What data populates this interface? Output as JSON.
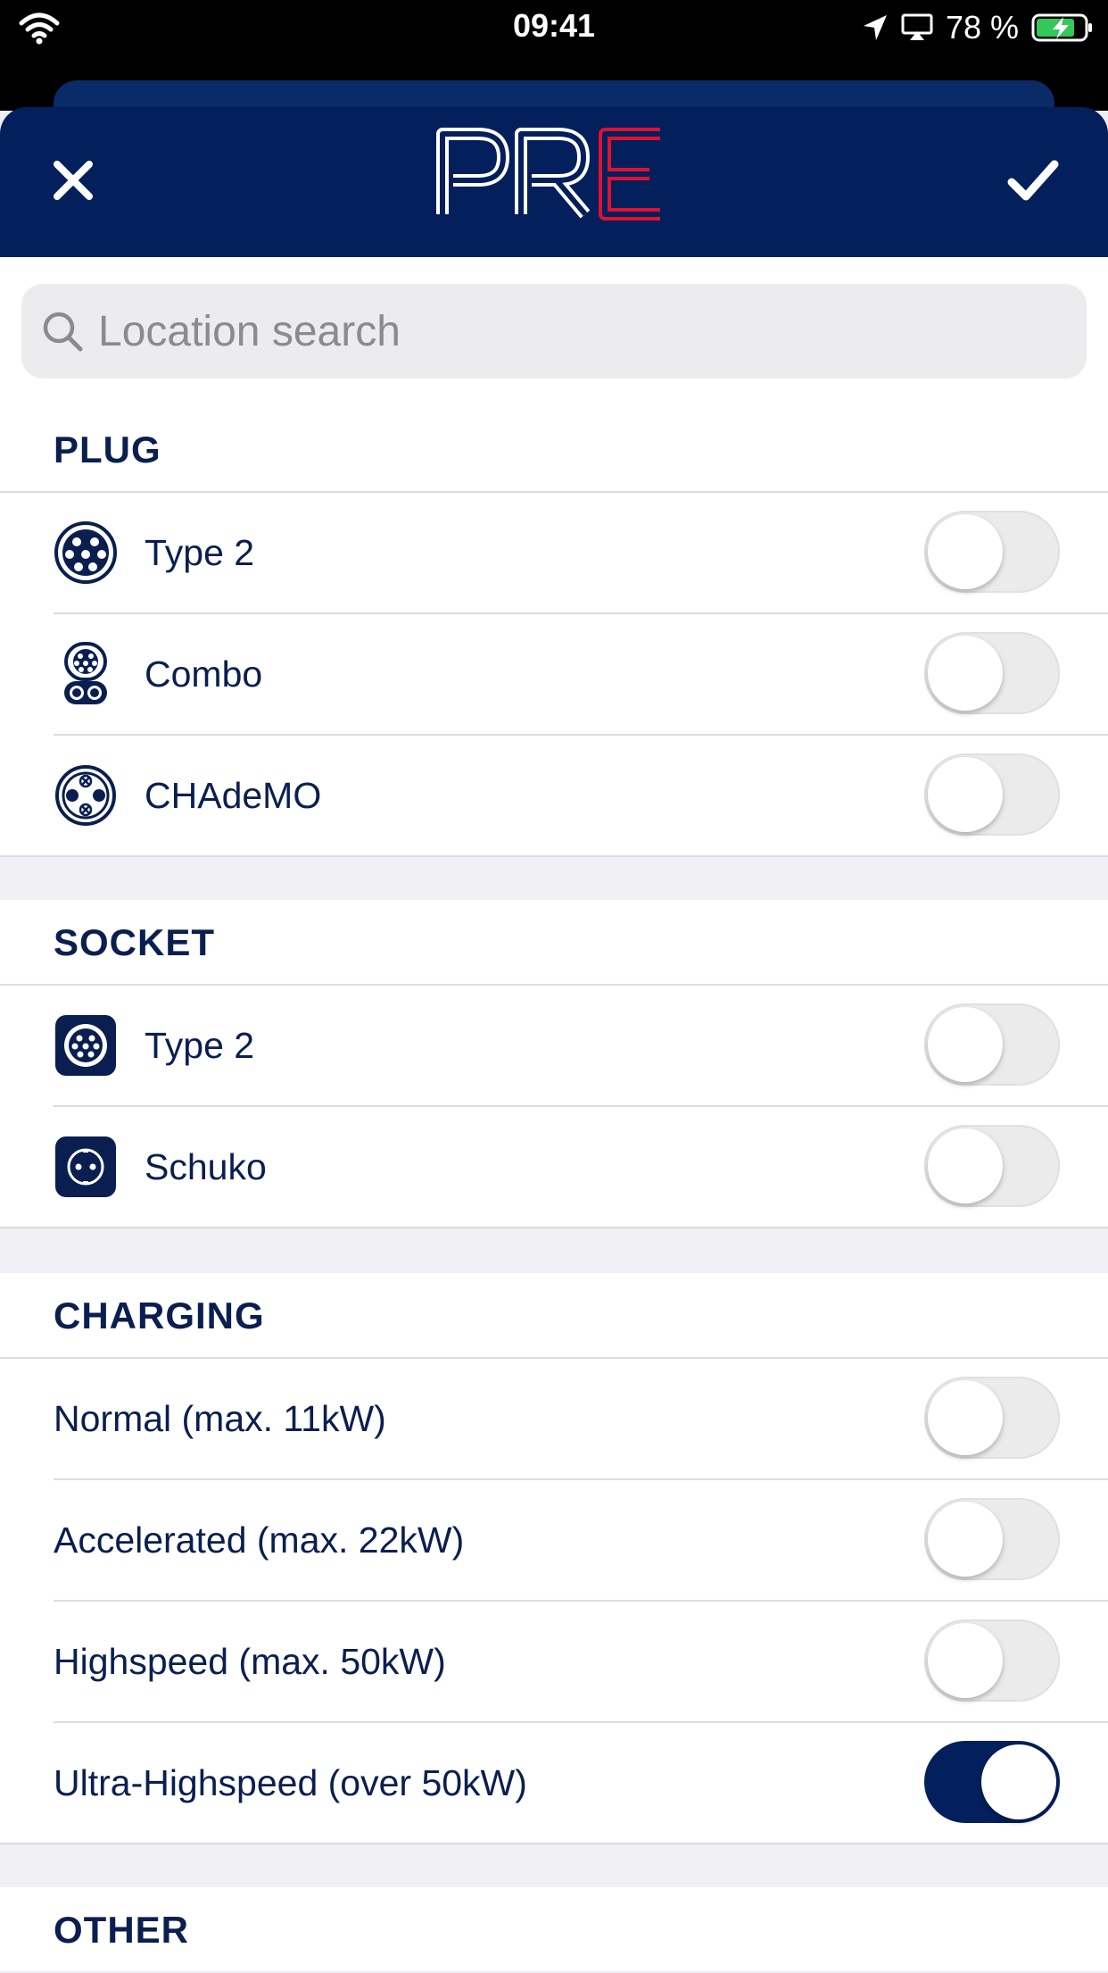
{
  "status_bar": {
    "time": "09:41",
    "battery": "78 %"
  },
  "header": {
    "logo_text": "PRE"
  },
  "search": {
    "placeholder": "Location search"
  },
  "sections": {
    "plug": {
      "title": "PLUG",
      "items": [
        {
          "label": "Type 2",
          "icon": "type2-plug-icon",
          "on": false
        },
        {
          "label": "Combo",
          "icon": "combo-plug-icon",
          "on": false
        },
        {
          "label": "CHAdeMO",
          "icon": "chademo-plug-icon",
          "on": false
        }
      ]
    },
    "socket": {
      "title": "SOCKET",
      "items": [
        {
          "label": "Type 2",
          "icon": "type2-socket-icon",
          "on": false
        },
        {
          "label": "Schuko",
          "icon": "schuko-socket-icon",
          "on": false
        }
      ]
    },
    "charging": {
      "title": "CHARGING",
      "items": [
        {
          "label": "Normal (max. 11kW)",
          "on": false
        },
        {
          "label": "Accelerated (max. 22kW)",
          "on": false
        },
        {
          "label": "Highspeed (max. 50kW)",
          "on": false
        },
        {
          "label": "Ultra-Highspeed (over 50kW)",
          "on": true
        }
      ]
    },
    "other": {
      "title": "OTHER"
    }
  },
  "colors": {
    "brand_navy": "#031f5c",
    "brand_red": "#e0102f"
  }
}
